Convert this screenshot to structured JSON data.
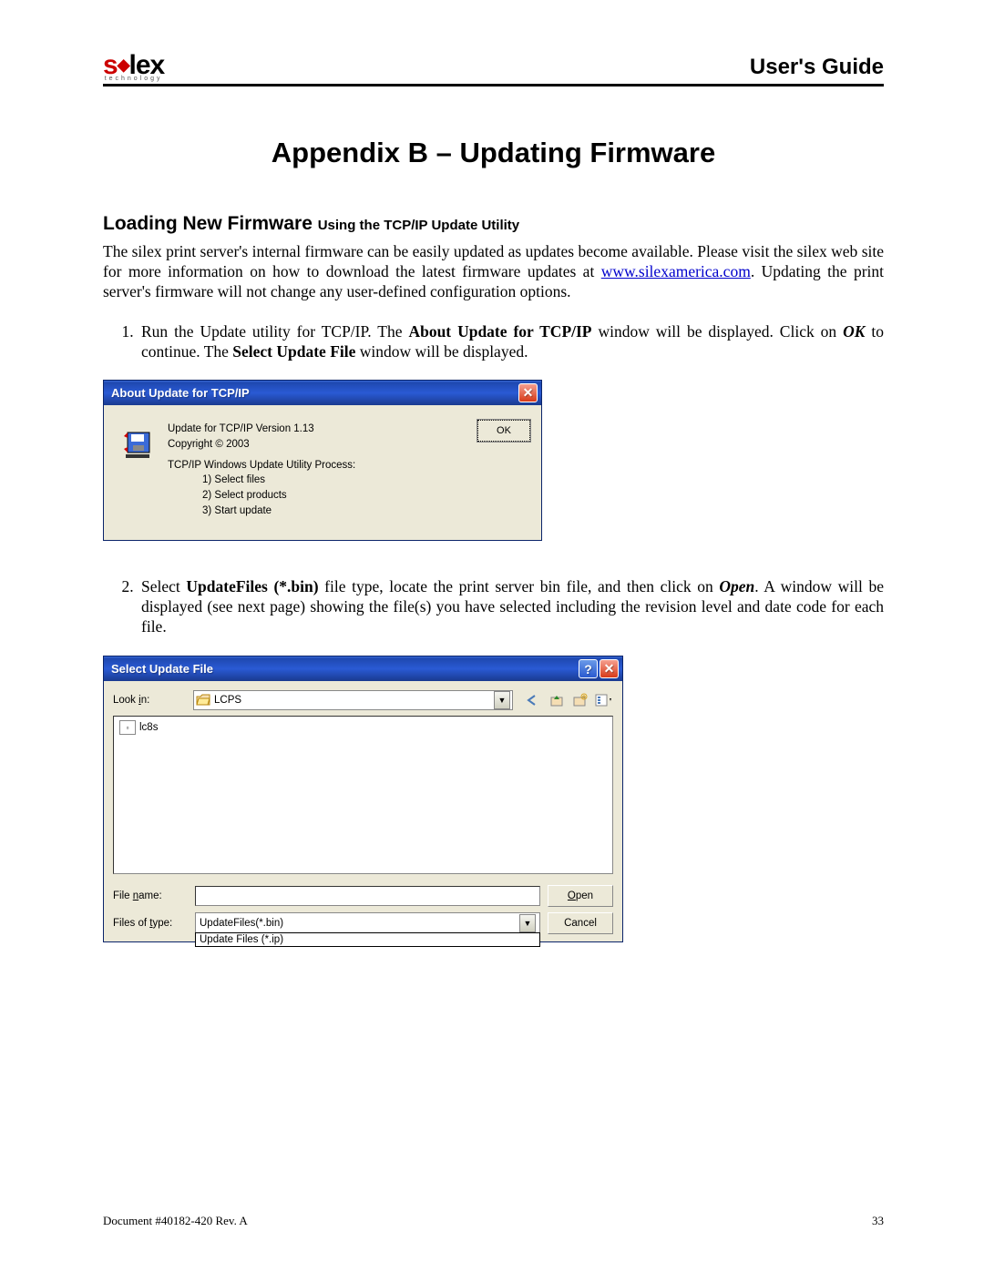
{
  "header": {
    "logo_main": "silex",
    "logo_sub": "technology",
    "guide": "User's Guide"
  },
  "title": "Appendix B – Updating Firmware",
  "section": {
    "heading_main": "Loading New Firmware ",
    "heading_sub": "Using the TCP/IP Update Utility"
  },
  "intro": {
    "part1": "The silex print server's internal firmware can be easily updated as updates become available.  Please visit the silex web site for more information on how to download the latest firmware updates at ",
    "link": "www.silexamerica.com",
    "part2": ".  Updating the print server's firmware will not change any user-defined configuration options."
  },
  "steps": {
    "s1": {
      "t1": "Run the Update utility for TCP/IP.  The ",
      "b1": "About Update for TCP/IP",
      "t2": " window will be displayed.  Click on ",
      "bi1": "OK",
      "t3": " to continue.  The ",
      "b2": "Select Update File",
      "t4": " window will be displayed."
    },
    "s2": {
      "t1": "Select ",
      "b1": "UpdateFiles (*.bin)",
      "t2": " file type, locate the print server bin file, and then click on ",
      "bi1": "Open",
      "t3": ".  A window will be displayed (see next page) showing the file(s) you have selected including the revision level and date code for each file."
    }
  },
  "dialog1": {
    "title": "About Update for TCP/IP",
    "line1": "Update for TCP/IP Version 1.13",
    "line2": "Copyright © 2003",
    "line3": "TCP/IP Windows Update Utility Process:",
    "line4": "1) Select files",
    "line5": "2) Select products",
    "line6": "3) Start update",
    "ok": "OK"
  },
  "dialog2": {
    "title": "Select Update File",
    "lookin_label": "Look in:",
    "lookin_value": "LCPS",
    "file1": "lc8s",
    "filename_label": "File name:",
    "filename_value": "",
    "filetype_label": "Files of type:",
    "filetype_value": "UpdateFiles(*.bin)",
    "filetype_option2": "Update Files (*.ip)",
    "open": "Open",
    "cancel": "Cancel"
  },
  "footer": {
    "doc": "Document #40182-420  Rev. A",
    "page": "33"
  }
}
